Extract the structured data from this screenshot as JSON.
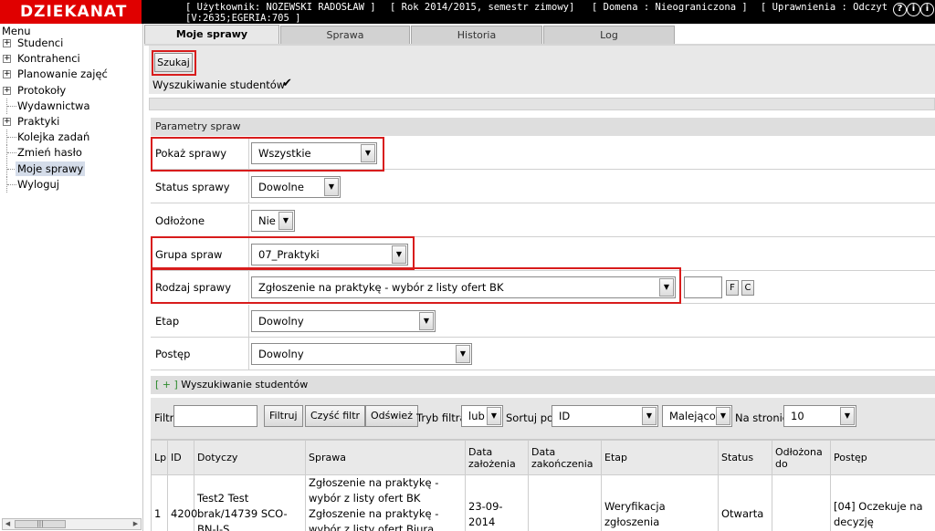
{
  "app": {
    "logo": "DZIEKANAT",
    "user": "[ Użytkownik: NOŻEWSKI RADOSŁAW ]",
    "user_line2": "[V:2635;EGERIA:705 ]",
    "term": "[ Rok 2014/2015, semestr zimowy]",
    "domain": "[ Domena : Nieograniczona ]",
    "permissions": "[ Uprawnienia : Odczyt ]",
    "icons": [
      "help-icon",
      "info-icon",
      "info-icon"
    ]
  },
  "menu": {
    "title": "Menu",
    "items": [
      {
        "label": "Studenci",
        "expandable": true
      },
      {
        "label": "Kontrahenci",
        "expandable": true
      },
      {
        "label": "Planowanie zajęć",
        "expandable": true
      },
      {
        "label": "Protokoły",
        "expandable": true
      },
      {
        "label": "Wydawnictwa",
        "expandable": false
      },
      {
        "label": "Praktyki",
        "expandable": true
      },
      {
        "label": "Kolejka zadań",
        "expandable": false
      },
      {
        "label": "Zmień hasło",
        "expandable": false
      },
      {
        "label": "Moje sprawy",
        "expandable": false,
        "active": true
      },
      {
        "label": "Wyloguj",
        "expandable": false
      }
    ]
  },
  "tabs": [
    {
      "label": "Moje sprawy",
      "active": true
    },
    {
      "label": "Sprawa",
      "active": false
    },
    {
      "label": "Historia",
      "active": false
    },
    {
      "label": "Log",
      "active": false
    }
  ],
  "search": {
    "button": "Szukaj",
    "students_label": "Wyszukiwanie studentów",
    "students_checked": "✔"
  },
  "params": {
    "header": "Parametry spraw",
    "rows": [
      {
        "label": "Pokaż sprawy",
        "value": "Wszystkie"
      },
      {
        "label": "Status sprawy",
        "value": "Dowolne"
      },
      {
        "label": "Odłożone",
        "value": "Nie"
      },
      {
        "label": "Grupa spraw",
        "value": "07_Praktyki"
      },
      {
        "label": "Rodzaj sprawy",
        "value": "Zgłoszenie na praktykę - wybór z listy ofert BK"
      },
      {
        "label": "Etap",
        "value": "Dowolny"
      },
      {
        "label": "Postęp",
        "value": "Dowolny"
      }
    ],
    "btn_f": "F",
    "btn_c": "C"
  },
  "students": {
    "plus": "[ + ]",
    "header": "Wyszukiwanie studentów"
  },
  "filter": {
    "label": "Filtr",
    "value": "",
    "btn_filter": "Filtruj",
    "btn_clear": "Czyść filtr",
    "btn_refresh": "Odśwież",
    "mode_label": "Tryb filtra",
    "mode_value": "lub",
    "sort_label": "Sortuj po",
    "sort_value": "ID",
    "order_value": "Malejąco",
    "per_page_label": "Na stronie",
    "per_page_value": "10"
  },
  "table": {
    "columns": [
      "Lp",
      "ID",
      "Dotyczy",
      "Sprawa",
      "Data założenia",
      "Data zakończenia",
      "Etap",
      "Status",
      "Odłożona do",
      "Postęp"
    ],
    "rows": [
      {
        "lp": "1",
        "id": "4200",
        "dotyczy": "Test2 Test brak/14739 SCO-BN-I-S",
        "sprawa": "Zgłoszenie na praktykę - wybór z listy ofert BK Zgłoszenie na praktykę - wybór z listy ofert Biura Karier",
        "data_zal": "23-09-2014",
        "data_zak": "",
        "etap": "Weryfikacja zgłoszenia",
        "status": "Otwarta",
        "odlozona": "",
        "postep": "[04] Oczekuje na decyzję"
      }
    ]
  },
  "colors": {
    "logo_bg": "#e00000",
    "highlight": "#d81c1c",
    "active_menu": "#d4dce9"
  }
}
